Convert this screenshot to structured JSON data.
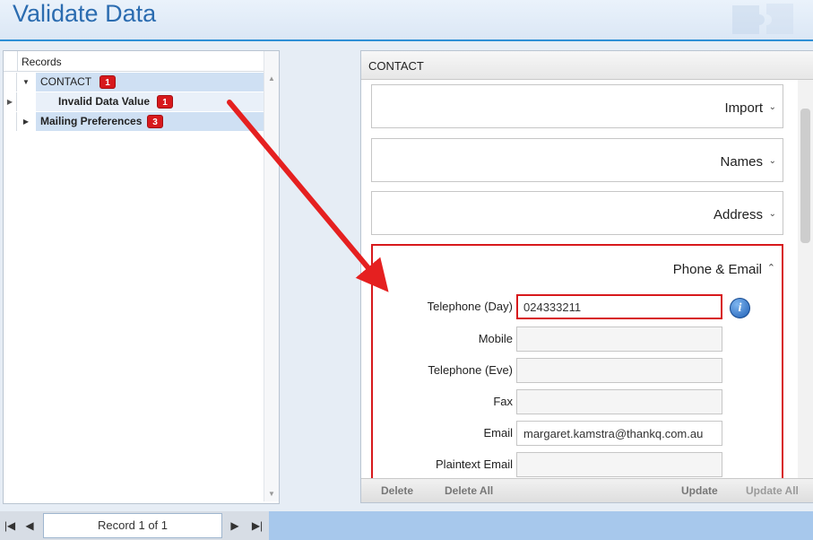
{
  "header": {
    "title": "Validate Data"
  },
  "records": {
    "column_header": "Records",
    "rows": [
      {
        "label": "CONTACT",
        "badge": "1",
        "expanded": true
      },
      {
        "label": "Invalid Data Value",
        "badge": "1"
      },
      {
        "label": "Mailing Preferences",
        "badge": "3",
        "expanded": false
      }
    ]
  },
  "detail": {
    "header": "CONTACT",
    "sections": {
      "import": "Import",
      "names": "Names",
      "address": "Address",
      "phone_email": "Phone & Email"
    },
    "fields": [
      {
        "label": "Telephone (Day)",
        "value": "024333211",
        "error": true
      },
      {
        "label": "Mobile",
        "value": ""
      },
      {
        "label": "Telephone (Eve)",
        "value": ""
      },
      {
        "label": "Fax",
        "value": ""
      },
      {
        "label": "Email",
        "value": "margaret.kamstra@thankq.com.au"
      },
      {
        "label": "Plaintext Email",
        "value": ""
      }
    ],
    "actions": {
      "delete": "Delete",
      "delete_all": "Delete All",
      "update": "Update",
      "update_all": "Update All"
    }
  },
  "navigation": {
    "record_text": "Record 1 of 1"
  },
  "icons": {
    "expand": "triangle-down-icon",
    "collapse": "triangle-right-icon",
    "section_collapsed": "chevron-down-icon",
    "section_expanded": "chevron-up-icon",
    "info": "info-icon",
    "first": "first-record-icon",
    "prev": "previous-record-icon",
    "next": "next-record-icon",
    "last": "last-record-icon"
  },
  "colors": {
    "accent": "#2b6cb0",
    "error": "#d7191c",
    "selection": "#cfe0f3",
    "navbar": "#a7c8ec"
  }
}
